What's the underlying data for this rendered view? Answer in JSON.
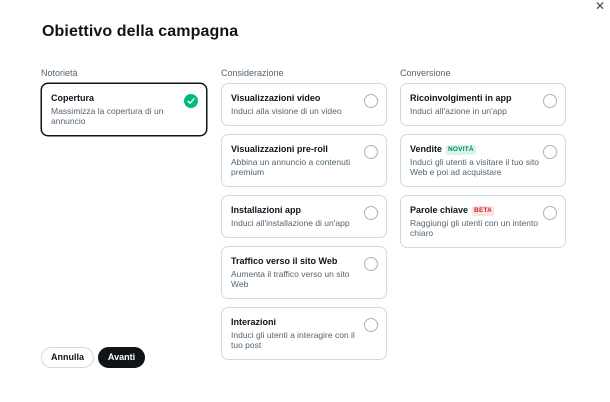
{
  "dialog": {
    "close_glyph": "✕",
    "title": "Obiettivo della campagna"
  },
  "columns": [
    {
      "label": "Notorietà",
      "cards": [
        {
          "title": "Copertura",
          "badge": "",
          "badge_type": "",
          "description": "Massimizza la copertura di un annuncio",
          "selected": true
        }
      ]
    },
    {
      "label": "Considerazione",
      "cards": [
        {
          "title": "Visualizzazioni video",
          "badge": "",
          "badge_type": "",
          "description": "Induci alla visione di un video",
          "selected": false
        },
        {
          "title": "Visualizzazioni pre-roll",
          "badge": "",
          "badge_type": "",
          "description": "Abbina un annuncio a contenuti premium",
          "selected": false
        },
        {
          "title": "Installazioni app",
          "badge": "",
          "badge_type": "",
          "description": "Induci all'installazione di un'app",
          "selected": false
        },
        {
          "title": "Traffico verso il sito Web",
          "badge": "",
          "badge_type": "",
          "description": "Aumenta il traffico verso un sito Web",
          "selected": false
        },
        {
          "title": "Interazioni",
          "badge": "",
          "badge_type": "",
          "description": "Induci gli utenti a interagire con il tuo post",
          "selected": false
        }
      ]
    },
    {
      "label": "Conversione",
      "cards": [
        {
          "title": "Ricoinvolgimenti in app",
          "badge": "",
          "badge_type": "",
          "description": "Induci all'azione in un'app",
          "selected": false
        },
        {
          "title": "Vendite",
          "badge": "NOVITÀ",
          "badge_type": "new",
          "description": "Induci gli utenti a visitare il tuo sito Web e poi ad acquistare",
          "selected": false
        },
        {
          "title": "Parole chiave",
          "badge": "BETA",
          "badge_type": "beta",
          "description": "Raggiungi gli utenti con un intento chiaro",
          "selected": false
        }
      ]
    }
  ],
  "actions": {
    "cancel_label": "Annulla",
    "next_label": "Avanti"
  },
  "colors": {
    "selected_check": "#00ba7c",
    "primary_button": "#0f1419",
    "badge_new_bg": "#d8f5e7",
    "badge_beta_bg": "#fde2e1"
  }
}
